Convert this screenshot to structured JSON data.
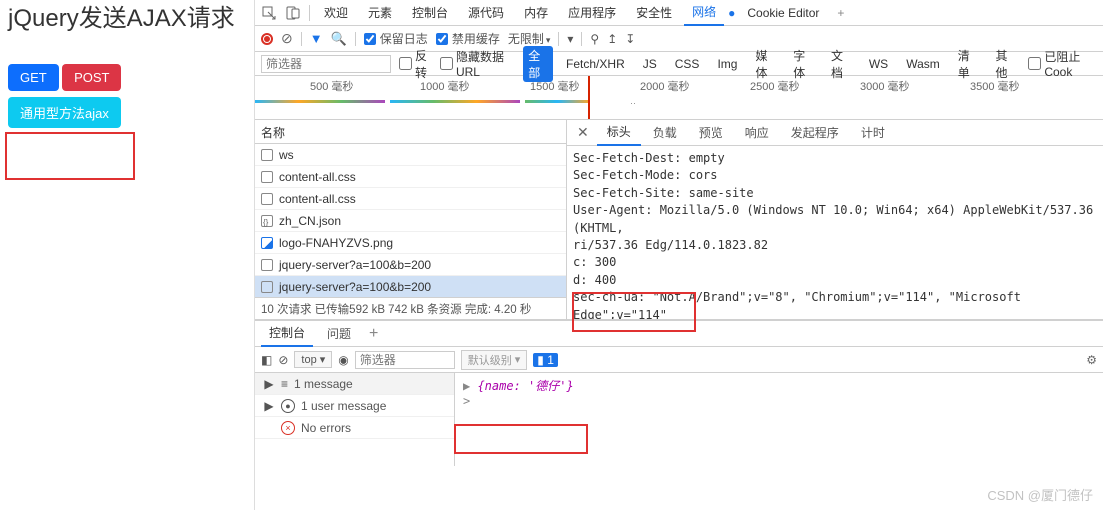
{
  "page": {
    "heading": "jQuery发送AJAX请求",
    "btn_get": "GET",
    "btn_post": "POST",
    "btn_ajax": "通用型方法ajax"
  },
  "toptabs": {
    "welcome": "欢迎",
    "elements": "元素",
    "console": "控制台",
    "sources": "源代码",
    "memory": "内存",
    "application": "应用程序",
    "security": "安全性",
    "network": "网络",
    "cookie": "Cookie Editor"
  },
  "tb2": {
    "preserve": "保留日志",
    "disable_cache": "禁用缓存",
    "throttle": "无限制"
  },
  "filter": {
    "placeholder": "筛选器",
    "invert": "反转",
    "hide_data": "隐藏数据 URL",
    "all": "全部",
    "fetch": "Fetch/XHR",
    "js": "JS",
    "css": "CSS",
    "img": "Img",
    "media": "媒体",
    "font": "字体",
    "doc": "文档",
    "ws": "WS",
    "wasm": "Wasm",
    "manifest": "清单",
    "other": "其他",
    "blocked": "已阻止 Cook"
  },
  "timeline": {
    "t1": "500 毫秒",
    "t2": "1000 毫秒",
    "t3": "1500 毫秒",
    "t4": "2000 毫秒",
    "t5": "2500 毫秒",
    "t6": "3000 毫秒",
    "t7": "3500 毫秒"
  },
  "netleft": {
    "header": "名称",
    "rows": [
      "ws",
      "content-all.css",
      "content-all.css",
      "zh_CN.json",
      "logo-FNAHYZVS.png",
      "jquery-server?a=100&b=200",
      "jquery-server?a=100&b=200"
    ],
    "status": "10 次请求  已传输592 kB  742 kB 条资源  完成: 4.20 秒"
  },
  "detail_tabs": {
    "headers": "标头",
    "payload": "负载",
    "preview": "预览",
    "response": "响应",
    "initiator": "发起程序",
    "timing": "计时"
  },
  "headers": {
    "l1": "Sec-Fetch-Dest: empty",
    "l2": "Sec-Fetch-Mode: cors",
    "l3": "Sec-Fetch-Site: same-site",
    "l4": "User-Agent: Mozilla/5.0 (Windows NT 10.0; Win64; x64) AppleWebKit/537.36 (KHTML,",
    "l5": "ri/537.36 Edg/114.0.1823.82",
    "l6": "c: 300",
    "l7": "d: 400",
    "l8": "sec-ch-ua: \"Not.A/Brand\";v=\"8\", \"Chromium\";v=\"114\", \"Microsoft Edge\";v=\"114\""
  },
  "drawer": {
    "console": "控制台",
    "issues": "问题"
  },
  "console_tb": {
    "ctx": "top",
    "filter_ph": "筛选器",
    "level": "默认级别",
    "issues": "1"
  },
  "messages": {
    "m1": "1 message",
    "m2": "1 user message",
    "m3": "No errors",
    "m4": ""
  },
  "console_out": {
    "line1": "{name: '德仔'}",
    "caret": ">"
  },
  "watermark": "CSDN @厦门德仔"
}
